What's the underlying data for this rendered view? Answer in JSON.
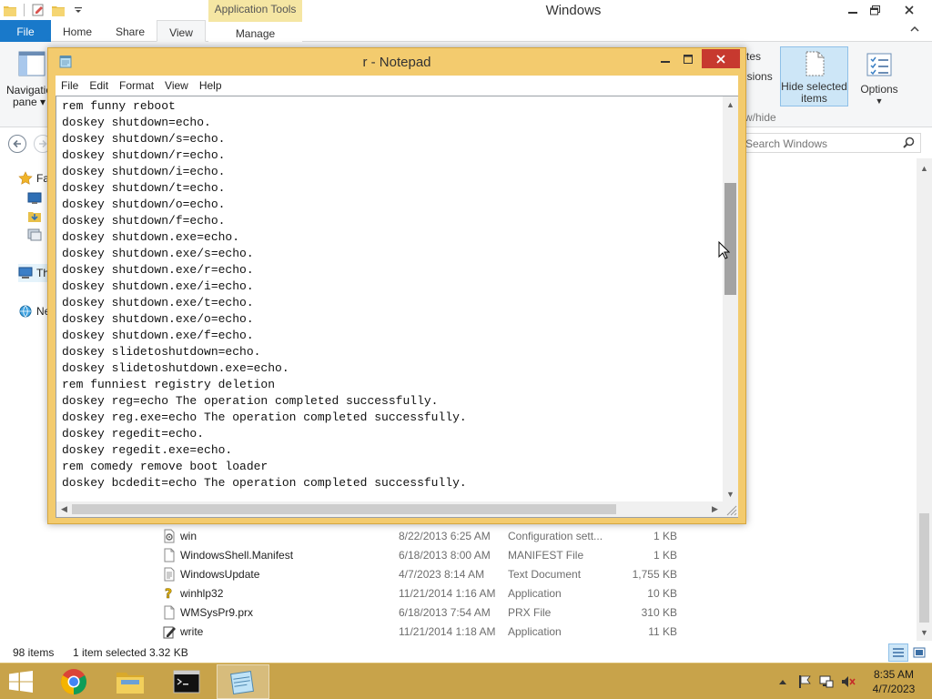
{
  "explorer": {
    "title": "Windows",
    "contextual_tab": "Application Tools",
    "tabs": [
      "File",
      "Home",
      "Share",
      "View",
      "Manage"
    ],
    "ribbon": {
      "nav_pane_line1": "Navigatio",
      "nav_pane_line2": "pane",
      "frag_tes": "tes",
      "frag_ensions": "nsions",
      "frag_wshide": "w/hide",
      "hide_selected_line1": "Hide selected",
      "hide_selected_line2": "items",
      "options": "Options"
    },
    "search_placeholder": "Search Windows",
    "nav_pane": {
      "fa": "Fa",
      "th": "Th",
      "ne": "Ne"
    },
    "files": [
      {
        "name": "win",
        "date": "8/22/2013 6:25 AM",
        "type": "Configuration sett...",
        "size": "1 KB",
        "icon": "config-file-icon"
      },
      {
        "name": "WindowsShell.Manifest",
        "date": "6/18/2013 8:00 AM",
        "type": "MANIFEST File",
        "size": "1 KB",
        "icon": "file-icon"
      },
      {
        "name": "WindowsUpdate",
        "date": "4/7/2023 8:14 AM",
        "type": "Text Document",
        "size": "1,755 KB",
        "icon": "text-file-icon"
      },
      {
        "name": "winhlp32",
        "date": "11/21/2014 1:16 AM",
        "type": "Application",
        "size": "10 KB",
        "icon": "help-app-icon"
      },
      {
        "name": "WMSysPr9.prx",
        "date": "6/18/2013 7:54 AM",
        "type": "PRX File",
        "size": "310 KB",
        "icon": "file-icon"
      },
      {
        "name": "write",
        "date": "11/21/2014 1:18 AM",
        "type": "Application",
        "size": "11 KB",
        "icon": "write-app-icon"
      }
    ],
    "status": {
      "items": "98 items",
      "selected": "1 item selected",
      "size": "3.32 KB"
    }
  },
  "notepad": {
    "title": "r - Notepad",
    "menu": [
      "File",
      "Edit",
      "Format",
      "View",
      "Help"
    ],
    "text": "rem funny reboot\ndoskey shutdown=echo.\ndoskey shutdown/s=echo.\ndoskey shutdown/r=echo.\ndoskey shutdown/i=echo.\ndoskey shutdown/t=echo.\ndoskey shutdown/o=echo.\ndoskey shutdown/f=echo.\ndoskey shutdown.exe=echo.\ndoskey shutdown.exe/s=echo.\ndoskey shutdown.exe/r=echo.\ndoskey shutdown.exe/i=echo.\ndoskey shutdown.exe/t=echo.\ndoskey shutdown.exe/o=echo.\ndoskey shutdown.exe/f=echo.\ndoskey slidetoshutdown=echo.\ndoskey slidetoshutdown.exe=echo.\nrem funniest registry deletion\ndoskey reg=echo The operation completed successfully.\ndoskey reg.exe=echo The operation completed successfully.\ndoskey regedit=echo.\ndoskey regedit.exe=echo.\nrem comedy remove boot loader\ndoskey bcdedit=echo The operation completed successfully."
  },
  "taskbar": {
    "apps": [
      {
        "name": "chrome",
        "icon": "chrome-icon"
      },
      {
        "name": "file-explorer",
        "icon": "folder-icon"
      },
      {
        "name": "command-prompt",
        "icon": "cmd-icon"
      },
      {
        "name": "notepad",
        "icon": "notepad-icon"
      }
    ],
    "time": "8:35 AM",
    "date": "4/7/2023"
  },
  "colors": {
    "accent_file_tab": "#1979ca",
    "window_frame": "#f3cb6e",
    "taskbar": "#c8a34a",
    "close_button": "#c7392f",
    "contextual_tab": "#f5e6a3"
  }
}
